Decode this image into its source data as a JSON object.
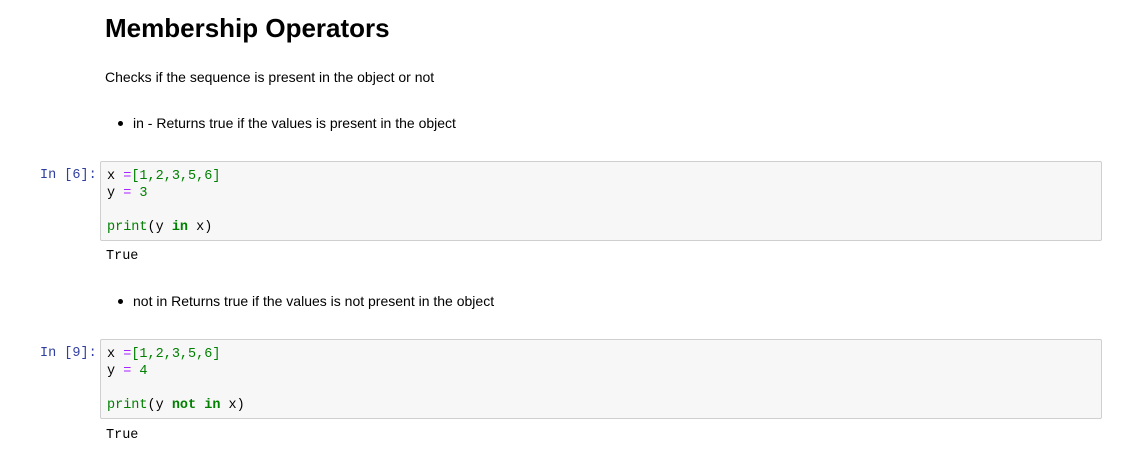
{
  "heading": "Membership Operators",
  "intro": "Checks if the sequence is present in the object or not",
  "cells": [
    {
      "bullet": "in - Returns true if the values is present in the object",
      "prompt": "In [6]:",
      "line1": {
        "var": "x",
        "eq": " =",
        "list": "[1,2,3,5,6]"
      },
      "line2": {
        "var": "y",
        "eq": " = ",
        "value": "3"
      },
      "line3": {
        "fn": "print",
        "open": "(y ",
        "kw1": "in",
        "kw2": "",
        "close": " x)"
      },
      "output": "True"
    },
    {
      "bullet": "not in Returns true if the values is not present in the object",
      "prompt": "In [9]:",
      "line1": {
        "var": "x",
        "eq": " =",
        "list": "[1,2,3,5,6]"
      },
      "line2": {
        "var": "y",
        "eq": " = ",
        "value": "4"
      },
      "line3": {
        "fn": "print",
        "open": "(y ",
        "kw1": "not",
        "kw2": "in",
        "close": " x)"
      },
      "output": "True"
    }
  ],
  "colors": {
    "prompt": "#303f9f",
    "keyword": "#008000",
    "number": "#008000",
    "cell_background": "#f7f7f7",
    "cell_border": "#cfcfcf"
  }
}
